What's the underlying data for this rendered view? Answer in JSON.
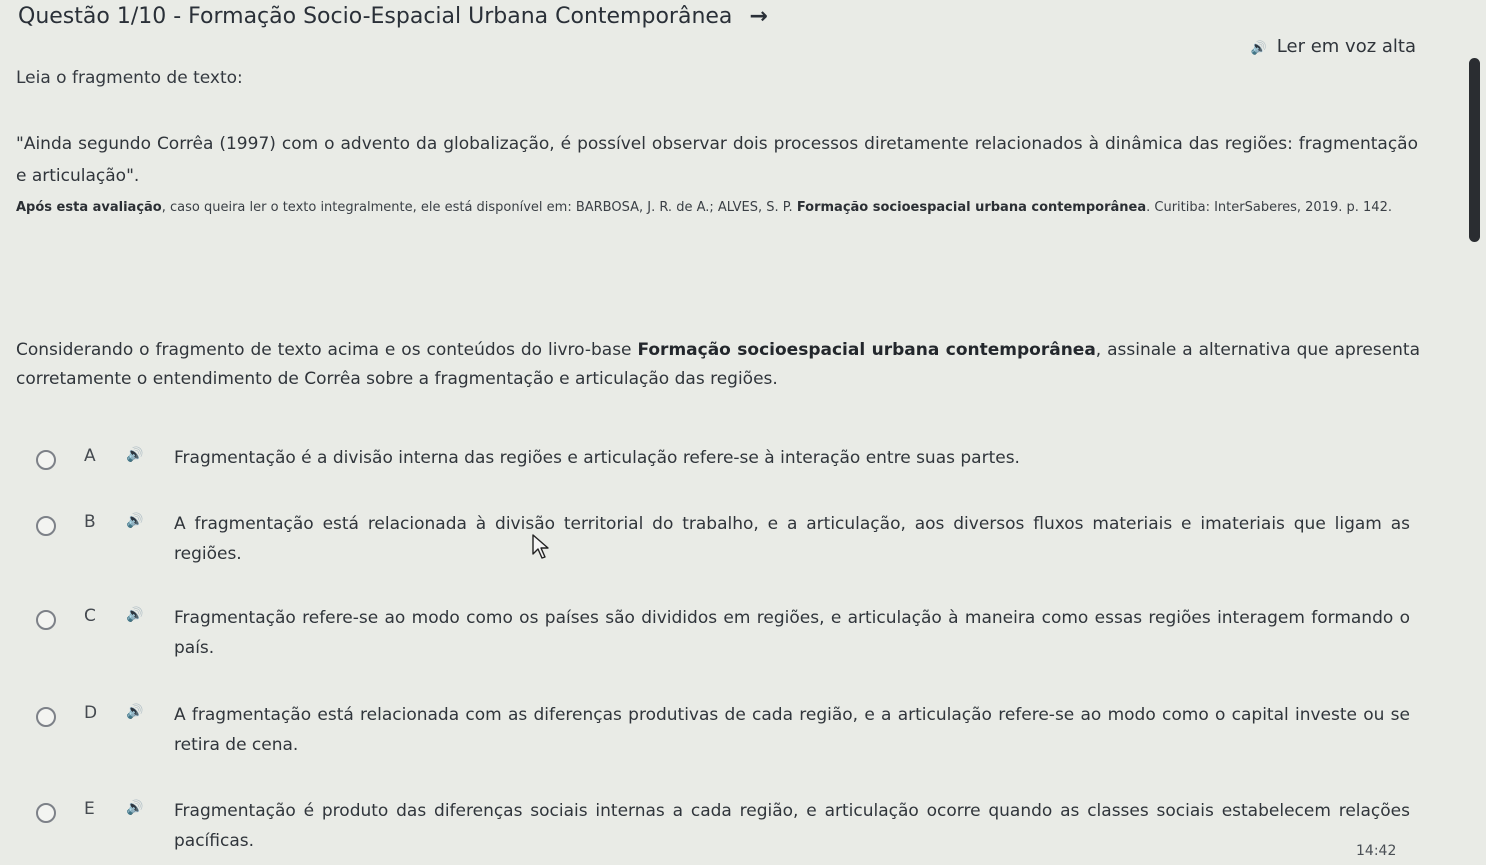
{
  "header": {
    "title": "Questão 1/10 - Formação Socio-Espacial Urbana Contemporânea",
    "next_arrow": "→",
    "tts_label": "Ler em voz alta",
    "tts_icon": "🔊"
  },
  "content": {
    "intro": "Leia o fragmento de texto:",
    "quote": "\"Ainda segundo Corrêa (1997) com o advento da globalização, é possível observar dois processos diretamente relacionados à dinâmica das regiões: fragmentação e articulação\".",
    "source_bold1": "Após esta avaliação",
    "source_text1": ", caso queira ler o texto integralmente, ele está disponível em: BARBOSA, J. R. de A.; ALVES, S. P. ",
    "source_bold2": "Formação socioespacial urbana contemporânea",
    "source_text2": ". Curitiba: InterSaberes, 2019. p. 142.",
    "statement_part1": "Considerando o fragmento de texto acima e os conteúdos do livro-base ",
    "statement_bold": "Formação socioespacial urbana contemporânea",
    "statement_part2": ", assinale a alternativa que apresenta corretamente o entendimento de Corrêa sobre a fragmentação e articulação das regiões."
  },
  "options": [
    {
      "letter": "A",
      "text": "Fragmentação é a divisão interna das regiões e articulação refere-se à interação entre suas partes."
    },
    {
      "letter": "B",
      "text": "A fragmentação está relacionada à divisão territorial do trabalho, e a articulação, aos diversos fluxos materiais e imateriais que ligam as regiões."
    },
    {
      "letter": "C",
      "text": "Fragmentação refere-se ao modo como os países são divididos em regiões, e articulação à maneira como essas regiões interagem formando o país."
    },
    {
      "letter": "D",
      "text": "A fragmentação está relacionada com as diferenças produtivas de cada região, e a articulação refere-se ao modo como o capital investe ou se retira de cena."
    },
    {
      "letter": "E",
      "text": "Fragmentação é produto das diferenças sociais internas a cada região, e articulação ocorre quando as classes sociais estabelecem relações pacíficas."
    }
  ],
  "taskbar": {
    "clock": "14:42"
  },
  "colors": {
    "background": "#e9ebe6",
    "text": "#30353b",
    "scrollbar": "#2a2d31"
  },
  "icons": {
    "speaker": "speaker-icon",
    "next": "arrow-right-icon",
    "radio": "radio-button"
  }
}
